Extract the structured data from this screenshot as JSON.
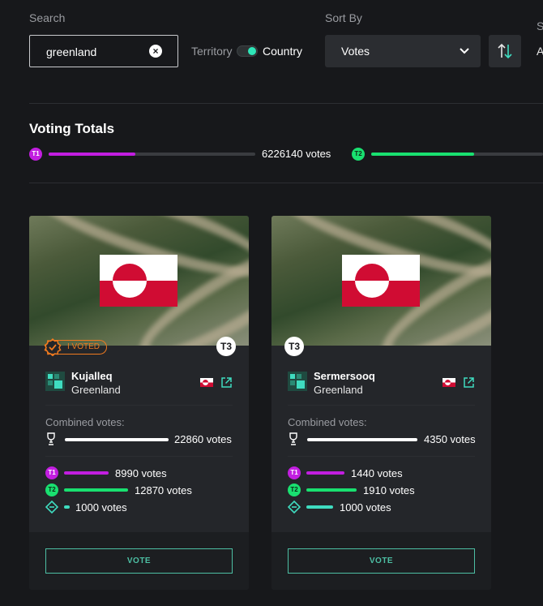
{
  "filters": {
    "search_label": "Search",
    "search_value": "greenland",
    "territory_label": "Territory",
    "country_label": "Country",
    "sort_label": "Sort By",
    "sort_value": "Votes",
    "cut_label_s": "S",
    "cut_label_a": "A"
  },
  "totals": {
    "title": "Voting Totals",
    "t1_badge": "T1",
    "t1_votes": "6226140 votes",
    "t1_fill": 0.42,
    "t2_badge": "T2",
    "t2_fill": 0.6
  },
  "cards": [
    {
      "tier": "T3",
      "voted_label": "I VOTED",
      "name": "Kujalleq",
      "country": "Greenland",
      "combined_label": "Combined votes:",
      "combined_votes": "22860 votes",
      "t1_badge": "T1",
      "t1_votes": "8990 votes",
      "t2_badge": "T2",
      "t2_votes": "12870 votes",
      "t3_votes": "1000 votes",
      "vote_label": "VOTE"
    },
    {
      "tier": "T3",
      "name": "Sermersooq",
      "country": "Greenland",
      "combined_label": "Combined votes:",
      "combined_votes": "4350 votes",
      "t1_badge": "T1",
      "t1_votes": "1440 votes",
      "t2_badge": "T2",
      "t2_votes": "1910 votes",
      "t3_votes": "1000 votes",
      "vote_label": "VOTE"
    }
  ],
  "colors": {
    "t1": "#c21ee0",
    "t2": "#19e070",
    "t3": "#3fdcc0",
    "accent": "#4dbfa4",
    "voted": "#f07a1f"
  }
}
